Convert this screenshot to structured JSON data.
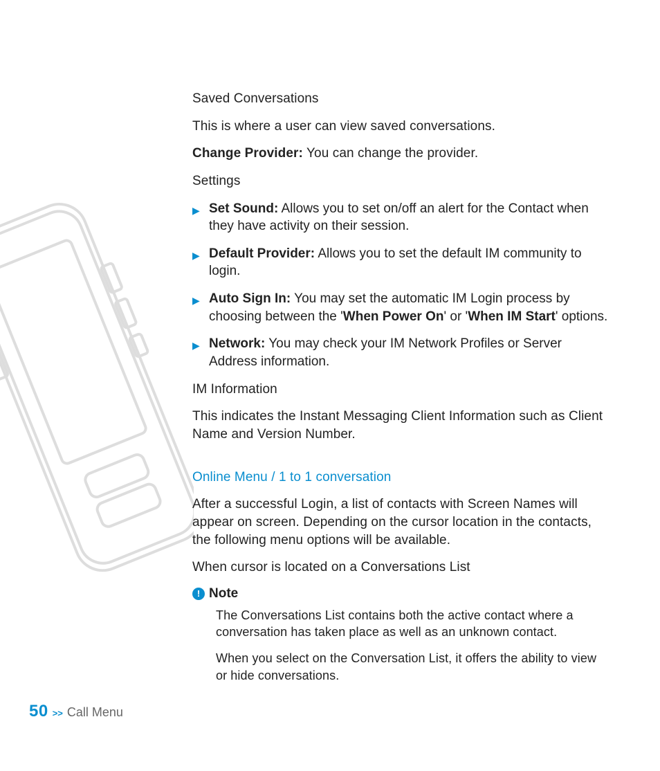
{
  "section1": {
    "saved_h": "Saved Conversations",
    "saved_body": "This is where a user can view saved conversations.",
    "change_label": "Change Provider:",
    "change_body": " You can change the provider.",
    "settings_h": "Settings",
    "bullets": [
      {
        "label": "Set Sound:",
        "body": " Allows you to set on/off an alert for the Contact when they have activity on their session."
      },
      {
        "label": "Default Provider:",
        "body": " Allows you to set the default IM community to login."
      },
      {
        "label": "Auto Sign In:",
        "body_a": " You may set the automatic IM Login process by choosing between the '",
        "opt1": "When Power On",
        "mid": "' or '",
        "opt2": "When IM Start",
        "body_b": "' options."
      },
      {
        "label": "Network:",
        "body": " You may check your IM Network Profiles or Server Address information."
      }
    ],
    "iminfo_h": "IM Information",
    "iminfo_body": "This indicates the Instant Messaging Client Information such as Client Name and Version Number."
  },
  "section2": {
    "h2": "Online Menu / 1 to 1 conversation",
    "intro": "After a successful Login, a list of contacts with Screen Names will appear on screen. Depending on the cursor location in the contacts, the following menu options will be available.",
    "h3": "When cursor is located on a Conversations List",
    "note_label": "Note",
    "note_p1": "The Conversations List contains both the active contact where a conversation has taken place as well as an unknown contact.",
    "note_p2": "When you select on the Conversation List, it offers the ability to view or hide conversations."
  },
  "footer": {
    "page_num": "50",
    "sep": ">>",
    "label": "Call Menu"
  }
}
